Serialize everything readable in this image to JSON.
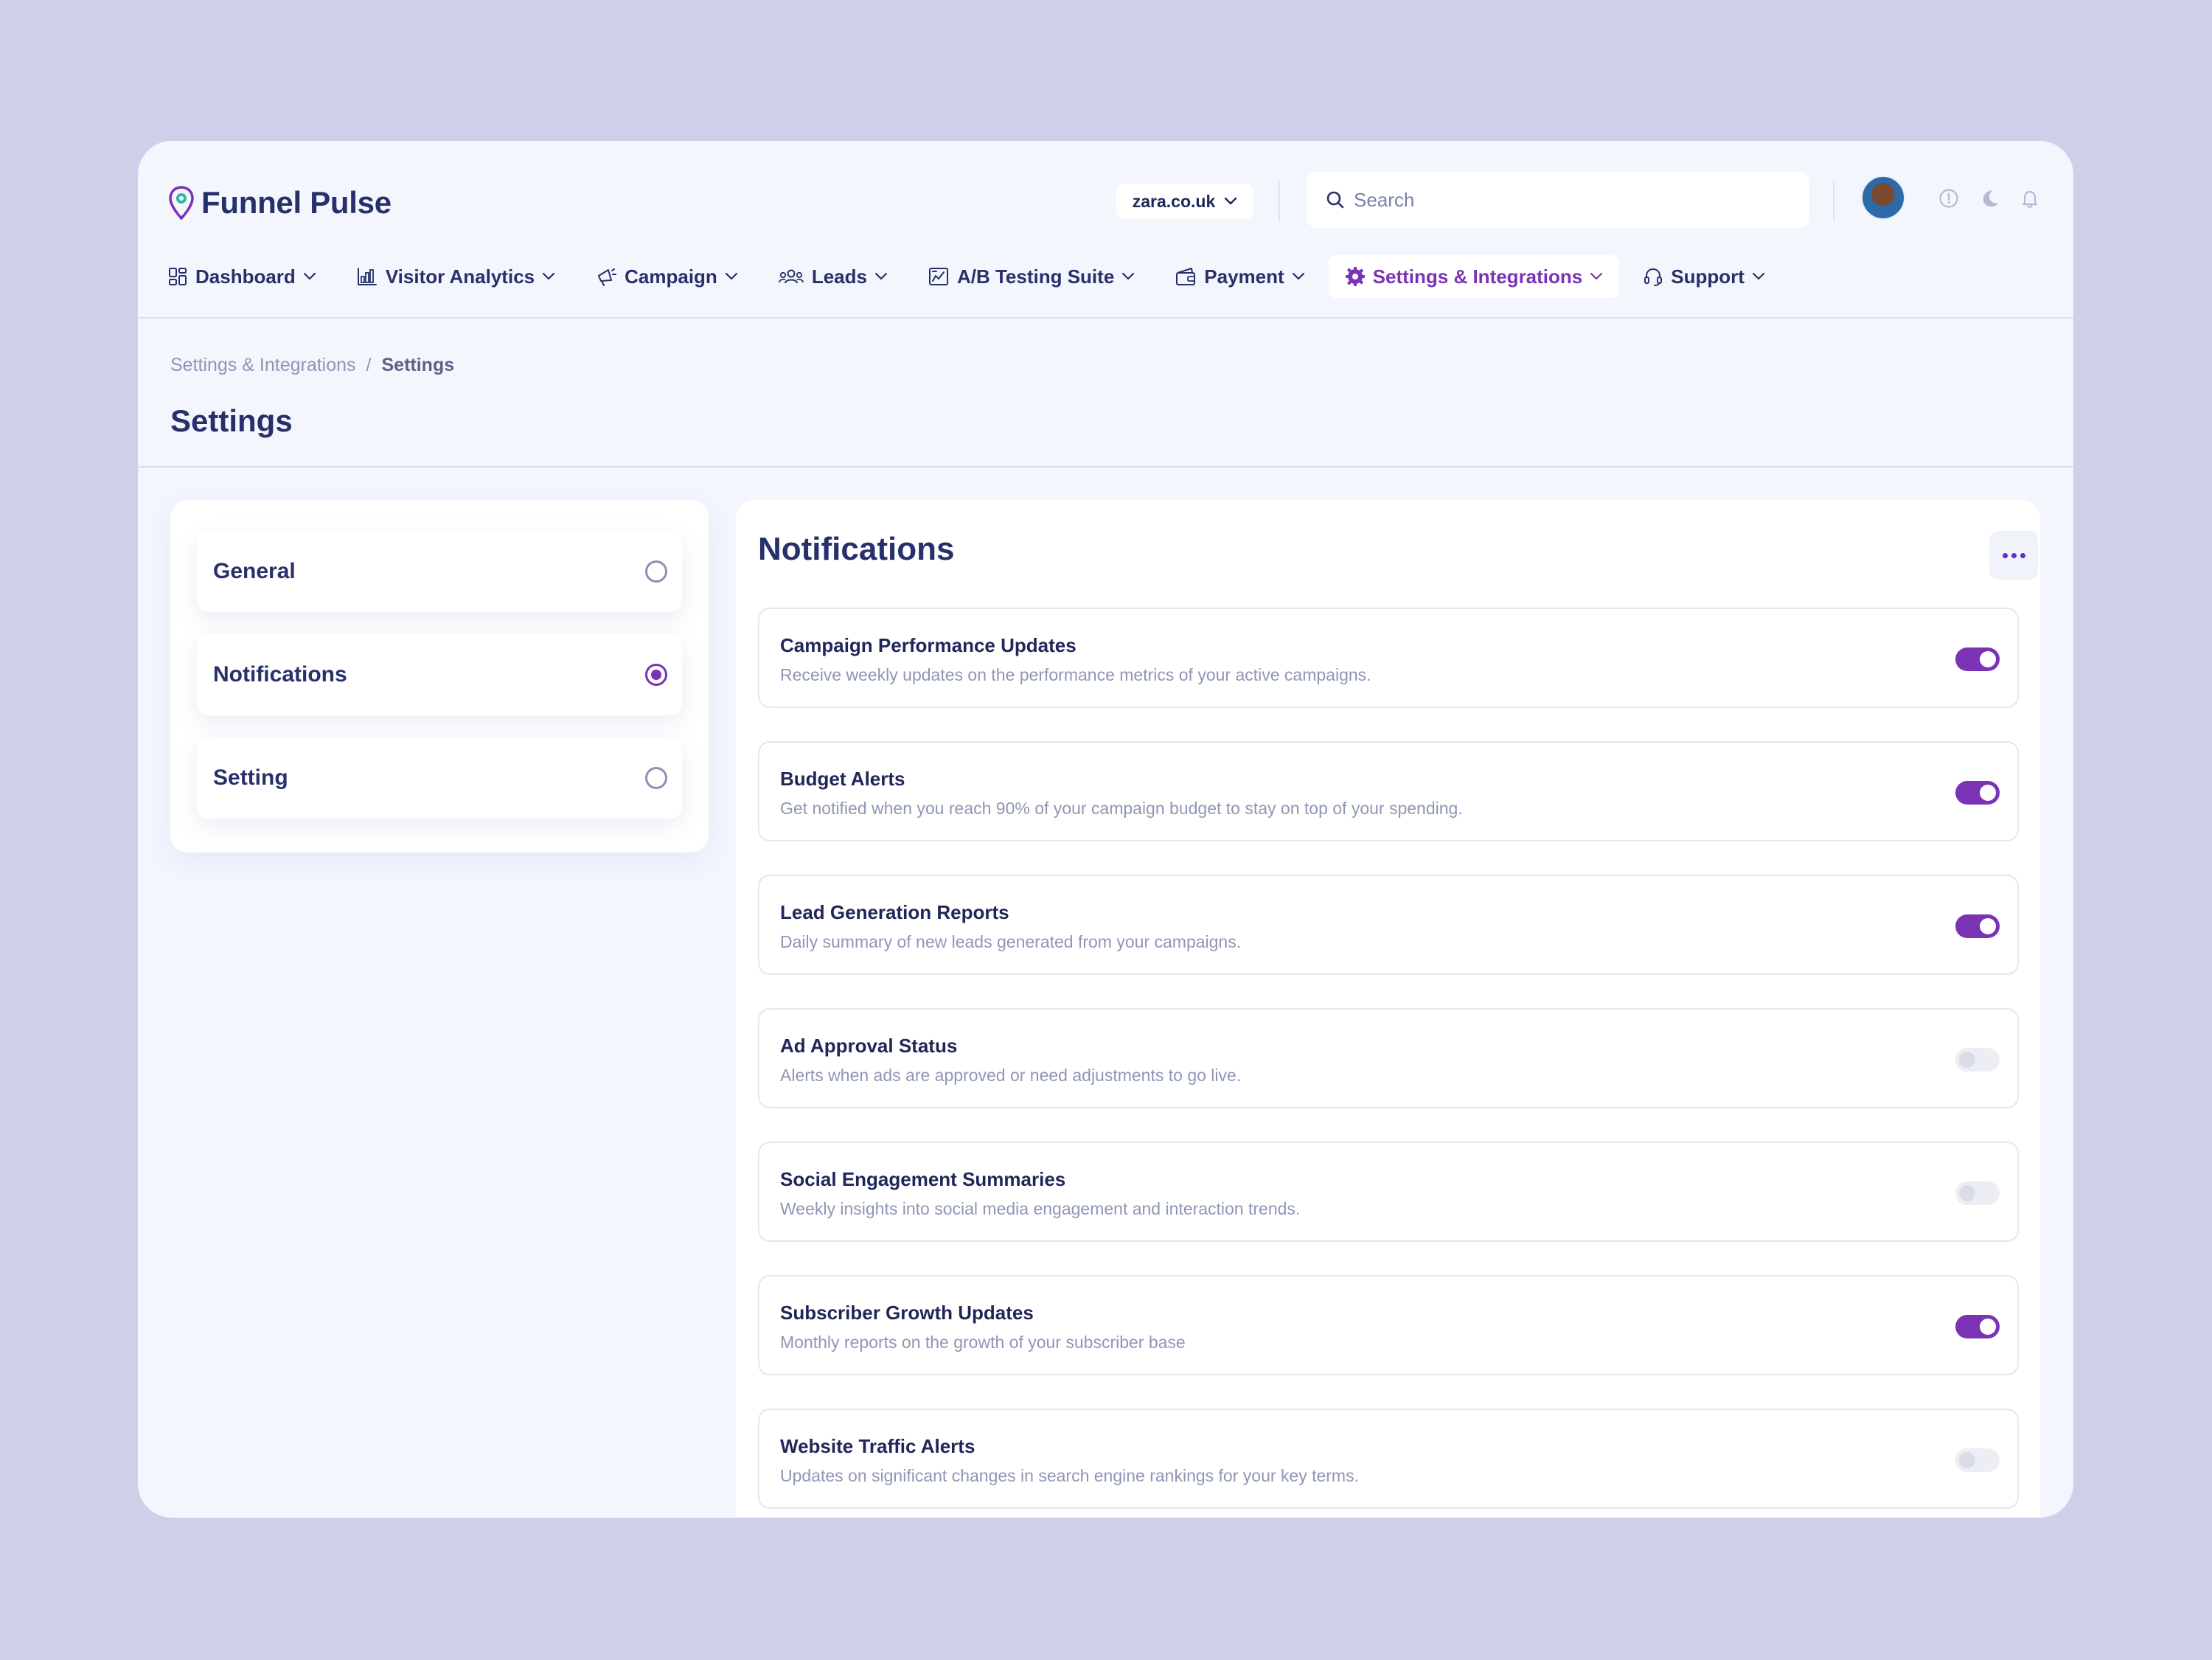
{
  "app": {
    "name": "Funnel Pulse"
  },
  "header": {
    "domain_select": "zara.co.uk",
    "search_placeholder": "Search"
  },
  "nav": [
    {
      "label": "Dashboard",
      "icon": "grid-icon"
    },
    {
      "label": "Visitor Analytics",
      "icon": "bar-chart-icon"
    },
    {
      "label": "Campaign",
      "icon": "megaphone-icon"
    },
    {
      "label": "Leads",
      "icon": "users-icon"
    },
    {
      "label": "A/B Testing Suite",
      "icon": "ab-test-icon"
    },
    {
      "label": "Payment",
      "icon": "wallet-icon"
    },
    {
      "label": "Settings & Integrations",
      "icon": "gear-icon",
      "active": true
    },
    {
      "label": "Support",
      "icon": "headset-icon"
    }
  ],
  "breadcrumb": {
    "parent": "Settings & Integrations",
    "separator": "/",
    "current": "Settings"
  },
  "page": {
    "title": "Settings"
  },
  "settings_menu": [
    {
      "label": "General",
      "selected": false
    },
    {
      "label": "Notifications",
      "selected": true
    },
    {
      "label": "Setting",
      "selected": false
    }
  ],
  "notifications": {
    "title": "Notifications",
    "items": [
      {
        "title": "Campaign Performance Updates",
        "description": "Receive weekly updates on the performance metrics of your active campaigns.",
        "enabled": true
      },
      {
        "title": "Budget Alerts",
        "description": "Get notified when you reach 90% of your campaign budget to stay on top of your spending.",
        "enabled": true
      },
      {
        "title": "Lead Generation Reports",
        "description": "Daily summary of new leads generated from your campaigns.",
        "enabled": true
      },
      {
        "title": "Ad Approval Status",
        "description": "Alerts when ads are approved or need adjustments to go live.",
        "enabled": false
      },
      {
        "title": "Social Engagement Summaries",
        "description": "Weekly insights into social media engagement and interaction trends.",
        "enabled": false
      },
      {
        "title": "Subscriber Growth Updates",
        "description": "Monthly reports on the growth of your subscriber base",
        "enabled": true
      },
      {
        "title": "Website Traffic Alerts",
        "description": "Updates on significant changes in search engine rankings for your key terms.",
        "enabled": false
      }
    ]
  },
  "colors": {
    "background": "#d0cfea",
    "app_bg": "#f3f6fd",
    "text_primary": "#27306a",
    "accent": "#7b33b5",
    "muted": "#8f96b5"
  }
}
